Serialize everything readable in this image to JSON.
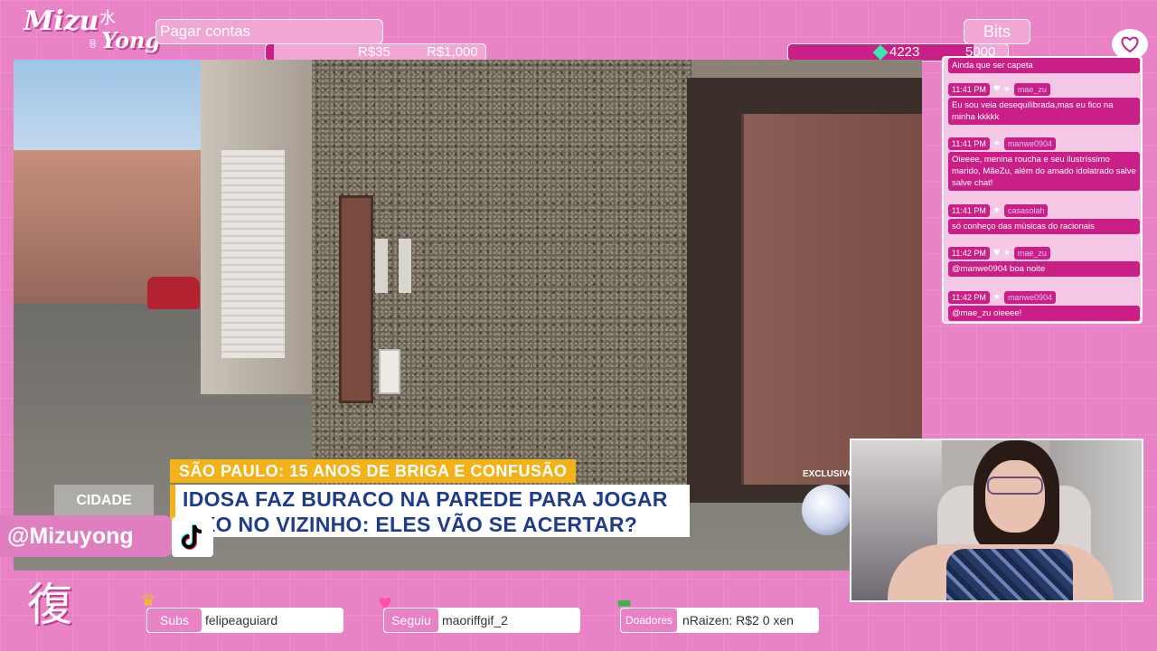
{
  "logo": {
    "mizu": "Mizu",
    "kanji": "水",
    "yong": "Yong",
    "sub": "용"
  },
  "goal": {
    "label": "Pagar contas",
    "current": "R$35",
    "target": "R$1,000",
    "progress": 0.035
  },
  "bits": {
    "label": "Bits",
    "current": "4223",
    "target": "5000",
    "progress": 0.845
  },
  "video": {
    "headline_top": "SÃO PAULO: 15 ANOS DE BRIGA E CONFUSÃO",
    "headline_main": "IDOSA FAZ BURACO NA PAREDE PARA JOGAR LIXO NO VIZINHO: ELES VÃO SE ACERTAR?",
    "exclusive": "EXCLUSIVO",
    "program_logo": "CIDADE"
  },
  "social": {
    "handle": "@Mizuyong",
    "platform_icon": "tiktok-icon"
  },
  "chat": {
    "partial_top": "Ainda que ser capeta",
    "messages": [
      {
        "time": "11:41 PM",
        "badges": "♥ ★",
        "user": "mae_zu",
        "text": "Eu sou veia desequilibrada,mas eu fico na minha kkkkk"
      },
      {
        "time": "11:41 PM",
        "badges": "★",
        "user": "manwe0904",
        "text": "Oieeee, menina roucha e seu ilustríssimo marido, MãeZu, além do amado idolatrado salve salve chat!"
      },
      {
        "time": "11:41 PM",
        "badges": "★",
        "user": "casasolah",
        "text": "só conheço das músicas do racionais"
      },
      {
        "time": "11:42 PM",
        "badges": "♥ ★",
        "user": "mae_zu",
        "text": "@manwe0904 boa noite"
      },
      {
        "time": "11:42 PM",
        "badges": "★",
        "user": "manwe0904",
        "text": "@mae_zu oieeee!"
      }
    ]
  },
  "footer": {
    "fuku": "復",
    "subs_label": "Subs",
    "subs_value": "felipeaguiard",
    "follow_label": "Seguiu",
    "follow_value": "maoriffgif_2",
    "donors_label": "Doadores",
    "donors_value": "nRaizen: R$2   0 xen"
  },
  "colors": {
    "accent": "#c91f86",
    "background": "#e983c6"
  }
}
